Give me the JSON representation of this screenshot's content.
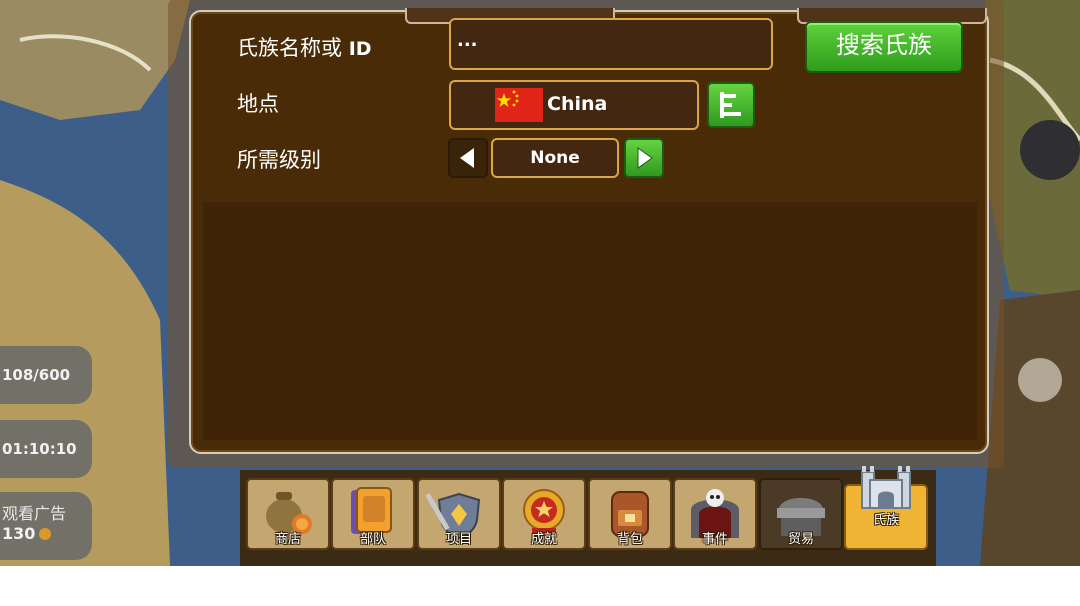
{
  "side_info": {
    "troops": "108/600",
    "timer": "01:10:10",
    "ad_label": "观看广告",
    "ad_reward": "130"
  },
  "search": {
    "name_label": "氏族名称或",
    "name_label_id": "ID",
    "name_value": "...",
    "search_button": "搜索氏族",
    "location_label": "地点",
    "location_value": "China",
    "level_label": "所需级别",
    "level_value": "None"
  },
  "icons": {
    "flag": "china-flag-icon",
    "list": "list-icon",
    "prev": "arrow-left-icon",
    "next": "arrow-right-icon"
  },
  "nav": [
    {
      "label": "商店",
      "icon": "money-bag-icon"
    },
    {
      "label": "部队",
      "icon": "card-icon"
    },
    {
      "label": "项目",
      "icon": "sword-shield-icon"
    },
    {
      "label": "成就",
      "icon": "medal-icon"
    },
    {
      "label": "背包",
      "icon": "backpack-icon"
    },
    {
      "label": "事件",
      "icon": "skull-gate-icon"
    },
    {
      "label": "贸易",
      "icon": "market-stall-icon"
    },
    {
      "label": "氏族",
      "icon": "castle-icon"
    }
  ],
  "colors": {
    "panel_bg": "#4a2b08",
    "field_border": "#d9a748",
    "button_green": "#3fb82a",
    "active_tab": "#f0b434"
  }
}
